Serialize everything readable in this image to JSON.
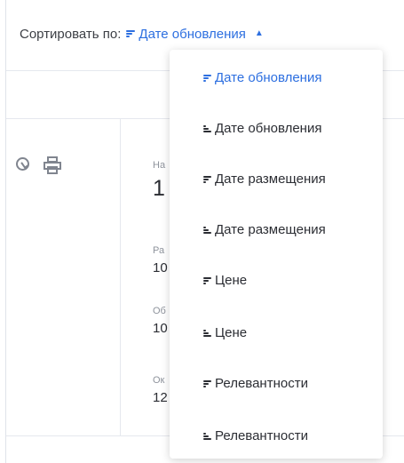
{
  "sort": {
    "prefix": "Сортировать по:",
    "current_label": "Дате обновления",
    "current_direction": "desc",
    "caret": "▲"
  },
  "card": {
    "labels": [
      "На",
      "Ра",
      "Об",
      "Ок"
    ],
    "big_value": "1",
    "values": [
      "10",
      "10",
      "12"
    ]
  },
  "dropdown": {
    "options": [
      {
        "label": "Дате обновления",
        "direction": "desc",
        "selected": true
      },
      {
        "label": "Дате обновления",
        "direction": "asc",
        "selected": false
      },
      {
        "label": "Дате размещения",
        "direction": "desc",
        "selected": false
      },
      {
        "label": "Дате размещения",
        "direction": "asc",
        "selected": false
      },
      {
        "label": "Цене",
        "direction": "desc",
        "selected": false
      },
      {
        "label": "Цене",
        "direction": "asc",
        "selected": false
      },
      {
        "label": "Релевантности",
        "direction": "desc",
        "selected": false
      },
      {
        "label": "Релевантности",
        "direction": "asc",
        "selected": false
      }
    ]
  },
  "icons": {
    "sort_desc": "sort-desc-icon",
    "sort_asc": "sort-asc-icon",
    "caret": "caret-up-icon",
    "key": "key-icon",
    "print": "printer-icon"
  },
  "colors": {
    "accent": "#2d6fe0",
    "text": "#2b2d33",
    "muted": "#8e939c",
    "border": "#e5e8ee",
    "icon": "#80858f"
  }
}
